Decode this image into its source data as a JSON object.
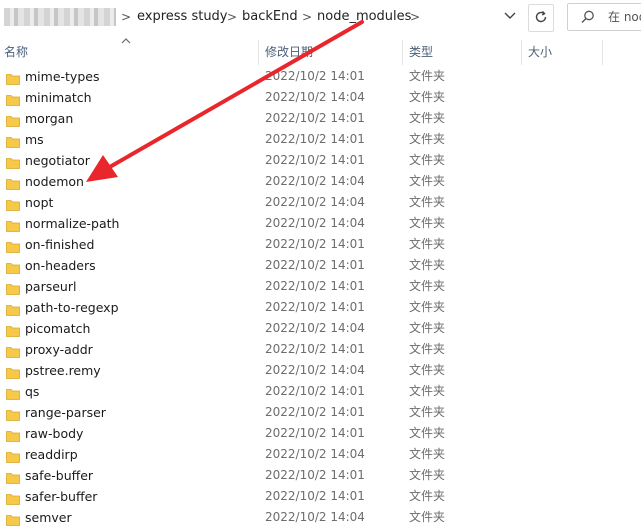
{
  "breadcrumb": {
    "items": [
      "express study",
      "backEnd",
      "node_modules"
    ],
    "separator": ">"
  },
  "search": {
    "placeholder": "在 node"
  },
  "columns": {
    "name": "名称",
    "date": "修改日期",
    "type": "类型",
    "size": "大小"
  },
  "files": [
    {
      "name": "mime-types",
      "date": "2022/10/2 14:01",
      "type": "文件夹"
    },
    {
      "name": "minimatch",
      "date": "2022/10/2 14:04",
      "type": "文件夹"
    },
    {
      "name": "morgan",
      "date": "2022/10/2 14:01",
      "type": "文件夹"
    },
    {
      "name": "ms",
      "date": "2022/10/2 14:01",
      "type": "文件夹"
    },
    {
      "name": "negotiator",
      "date": "2022/10/2 14:01",
      "type": "文件夹"
    },
    {
      "name": "nodemon",
      "date": "2022/10/2 14:04",
      "type": "文件夹"
    },
    {
      "name": "nopt",
      "date": "2022/10/2 14:04",
      "type": "文件夹"
    },
    {
      "name": "normalize-path",
      "date": "2022/10/2 14:04",
      "type": "文件夹"
    },
    {
      "name": "on-finished",
      "date": "2022/10/2 14:01",
      "type": "文件夹"
    },
    {
      "name": "on-headers",
      "date": "2022/10/2 14:01",
      "type": "文件夹"
    },
    {
      "name": "parseurl",
      "date": "2022/10/2 14:01",
      "type": "文件夹"
    },
    {
      "name": "path-to-regexp",
      "date": "2022/10/2 14:01",
      "type": "文件夹"
    },
    {
      "name": "picomatch",
      "date": "2022/10/2 14:04",
      "type": "文件夹"
    },
    {
      "name": "proxy-addr",
      "date": "2022/10/2 14:01",
      "type": "文件夹"
    },
    {
      "name": "pstree.remy",
      "date": "2022/10/2 14:04",
      "type": "文件夹"
    },
    {
      "name": "qs",
      "date": "2022/10/2 14:01",
      "type": "文件夹"
    },
    {
      "name": "range-parser",
      "date": "2022/10/2 14:01",
      "type": "文件夹"
    },
    {
      "name": "raw-body",
      "date": "2022/10/2 14:01",
      "type": "文件夹"
    },
    {
      "name": "readdirp",
      "date": "2022/10/2 14:04",
      "type": "文件夹"
    },
    {
      "name": "safe-buffer",
      "date": "2022/10/2 14:01",
      "type": "文件夹"
    },
    {
      "name": "safer-buffer",
      "date": "2022/10/2 14:01",
      "type": "文件夹"
    },
    {
      "name": "semver",
      "date": "2022/10/2 14:04",
      "type": "文件夹"
    }
  ],
  "colors": {
    "folder": "#f7c948",
    "arrow": "#e8262b",
    "header_text": "#4c607a"
  },
  "icons": {
    "dropdown": "chevron-down-icon",
    "refresh": "refresh-icon",
    "search": "search-icon",
    "folder": "folder-icon",
    "sort": "sort-up-icon"
  }
}
